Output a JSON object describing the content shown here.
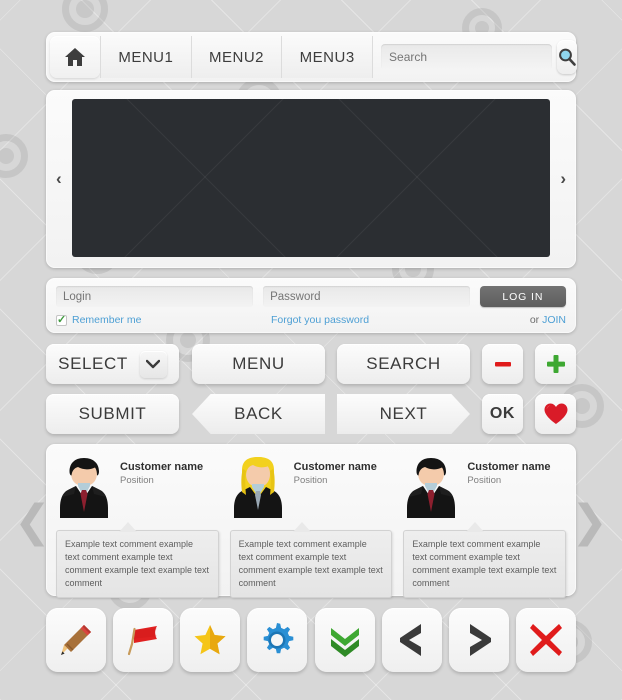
{
  "navbar": {
    "home_icon": "home-icon",
    "menu_items": [
      "MENU1",
      "MENU2",
      "MENU3"
    ],
    "search": {
      "placeholder": "Search",
      "value": "",
      "button_icon": "magnifier-icon"
    }
  },
  "slider": {
    "prev_arrow": "‹",
    "next_arrow": "›",
    "stage_color": "#2b2e32"
  },
  "login": {
    "login_placeholder": "Login",
    "login_value": "",
    "password_placeholder": "Password",
    "password_value": "",
    "login_button": "LOG IN",
    "remember_label": "Remember me",
    "remember_checked": true,
    "forgot_label": "Forgot you password",
    "or_label": "or ",
    "join_label": "JOIN",
    "link_color": "#4d9fd4",
    "button_color": "#656565"
  },
  "buttons": {
    "select": "SELECT",
    "select_chevron": "chevron-down-icon",
    "menu": "MENU",
    "search": "SEARCH",
    "minus_icon": "minus-icon",
    "plus_icon": "plus-icon",
    "submit": "SUBMIT",
    "back": "BACK",
    "next": "NEXT",
    "ok": "OK",
    "heart_icon": "heart-icon",
    "minus_color": "#e01b1b",
    "plus_color": "#3ea832",
    "heart_color": "#d91b28"
  },
  "testimonials": {
    "prev_arrow": "❮",
    "next_arrow": "❯",
    "cards": [
      {
        "avatar": "male-avatar",
        "name": "Customer name",
        "position": "Position",
        "comment": "Example text comment example text comment example text comment example text example text comment"
      },
      {
        "avatar": "female-avatar",
        "name": "Customer name",
        "position": "Position",
        "comment": "Example text comment example text comment example text comment example text example text comment"
      },
      {
        "avatar": "male-avatar",
        "name": "Customer name",
        "position": "Position",
        "comment": "Example text comment example text comment example text comment example text example text comment"
      }
    ]
  },
  "icon_row": [
    {
      "name": "pencil-icon",
      "color": "#8a5a2b"
    },
    {
      "name": "flag-icon",
      "color": "#e02020"
    },
    {
      "name": "star-icon",
      "color": "#f5c518"
    },
    {
      "name": "gear-icon",
      "color": "#2a8fd4"
    },
    {
      "name": "double-chevron-down-icon",
      "color": "#3ea832"
    },
    {
      "name": "chevron-left-icon",
      "color": "#3a3a3a"
    },
    {
      "name": "chevron-right-icon",
      "color": "#3a3a3a"
    },
    {
      "name": "close-x-icon",
      "color": "#e01b1b"
    }
  ]
}
